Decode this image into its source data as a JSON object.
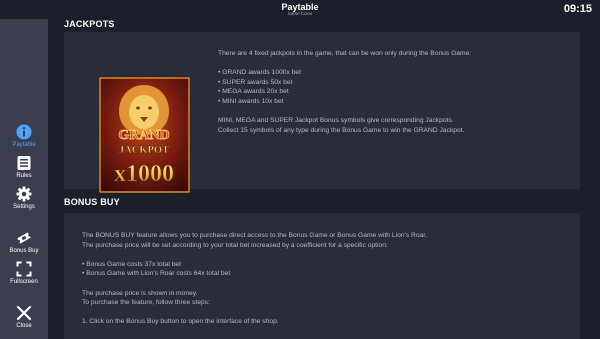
{
  "header": {
    "title": "Paytable",
    "subtitle": "Safari Coins",
    "clock": "09:15"
  },
  "sidebar": {
    "items": [
      {
        "label": "Paytable",
        "icon": "info-icon",
        "active": true
      },
      {
        "label": "Rules",
        "icon": "rules-icon",
        "active": false
      },
      {
        "label": "Settings",
        "icon": "gear-icon",
        "active": false
      },
      {
        "label": "Bonus Buy",
        "icon": "ticket-icon",
        "active": false
      },
      {
        "label": "Fullscreen",
        "icon": "fullscreen-icon",
        "active": false
      },
      {
        "label": "Close",
        "icon": "close-icon",
        "active": false
      }
    ]
  },
  "colors": {
    "accent": "#4ea3ff",
    "background": "#1b1f2c",
    "sidebar": "#3a3e4e",
    "panel": "#292d3a",
    "gold": "#f5c542"
  },
  "jackpots": {
    "title": "JACKPOTS",
    "image_text": {
      "grand": "GRAND",
      "jackpot": "JACKPOT",
      "multiplier": "x1000"
    },
    "lines": [
      "There are 4 fixed jackpots in the game, that can be won only during the Bonus Game:",
      "",
      "• GRAND awards 1000x bet",
      "• SUPER awards 50x bet",
      "• MEGA awards 20x bet",
      "• MINI awards 10x bet",
      "",
      "MINI, MEGA and SUPER Jackpot Bonus symbols give corresponding Jackpots.",
      "Collect 15 symbols of any type during the Bonus Game to win the GRAND Jackpot."
    ]
  },
  "bonus_buy": {
    "title": "BONUS BUY",
    "lines": [
      "The BONUS BUY feature allows you to purchase direct access to the Bonus Game or Bonus Game with Lion's Roar.",
      "The purchase price will be set according to your total bet increased by a coefficient for a specific option:",
      "",
      "• Bonus Game costs  37x total bet",
      "• Bonus Game with Lion's Roar costs 64x total bet",
      "",
      "The purchase price is shown in money.",
      "To purchase the feature, follow three steps:",
      "",
      "1. Click on the Bonus Buy button to open the interface of the shop."
    ]
  }
}
